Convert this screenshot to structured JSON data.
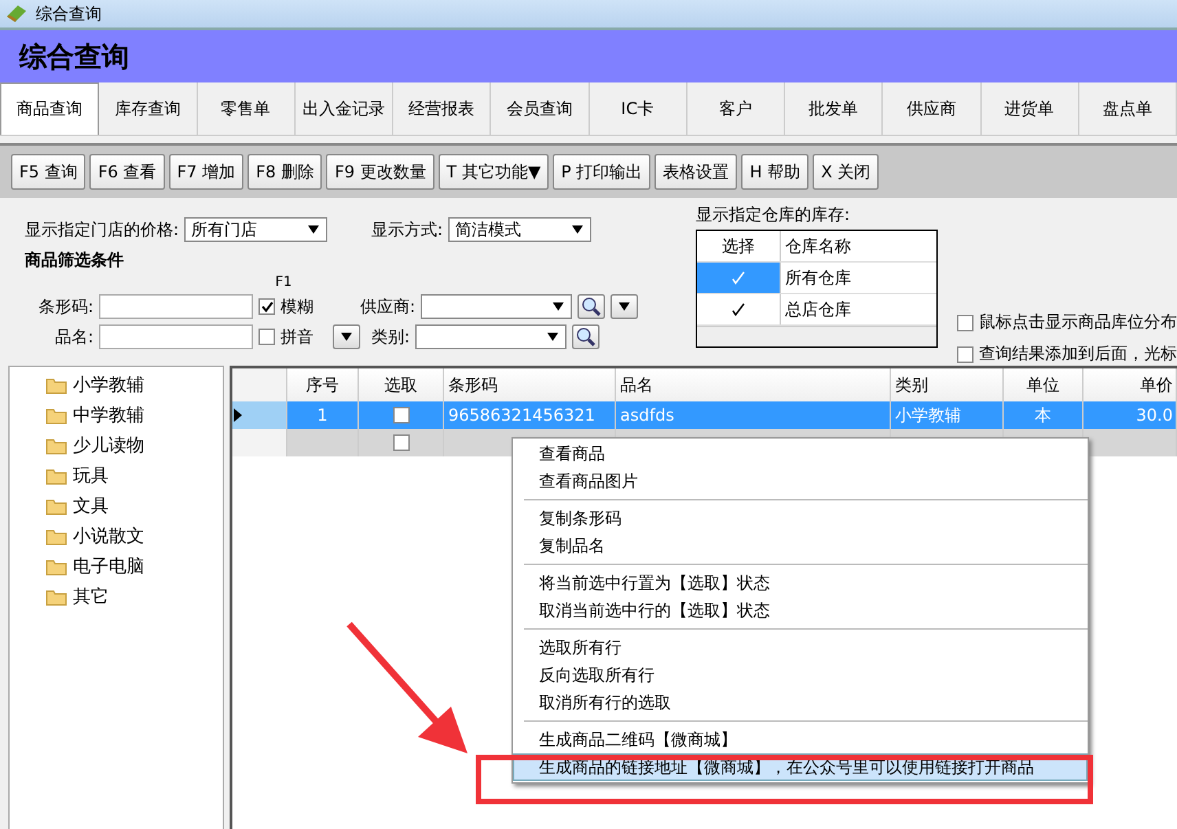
{
  "window": {
    "title": "综合查询"
  },
  "header": {
    "title": "综合查询"
  },
  "tabs": [
    {
      "label": "商品查询",
      "selected": true
    },
    {
      "label": "库存查询",
      "selected": false
    },
    {
      "label": "零售单",
      "selected": false
    },
    {
      "label": "出入金记录",
      "selected": false
    },
    {
      "label": "经营报表",
      "selected": false
    },
    {
      "label": "会员查询",
      "selected": false
    },
    {
      "label": "IC卡",
      "selected": false
    },
    {
      "label": "客户",
      "selected": false
    },
    {
      "label": "批发单",
      "selected": false
    },
    {
      "label": "供应商",
      "selected": false
    },
    {
      "label": "进货单",
      "selected": false
    },
    {
      "label": "盘点单",
      "selected": false
    }
  ],
  "toolbar": [
    "F5 查询",
    "F6 查看",
    "F7 增加",
    "F8 删除",
    "F9 更改数量",
    "T 其它功能▼",
    "P 打印输出",
    "表格设置",
    "H 帮助",
    "X 关闭"
  ],
  "filters": {
    "store_label": "显示指定门店的价格:",
    "store_value": "所有门店",
    "mode_label": "显示方式:",
    "mode_value": "简洁模式",
    "section_title": "商品筛选条件",
    "barcode_label": "条形码:",
    "f1_hint": "F1",
    "fuzzy": {
      "label": "模糊",
      "checked": true
    },
    "supplier_label": "供应商:",
    "name_label": "品名:",
    "pinyin": {
      "label": "拼音",
      "checked": false
    },
    "category_label": "类别:"
  },
  "warehouse": {
    "label": "显示指定仓库的库存:",
    "columns": [
      "选择",
      "仓库名称"
    ],
    "rows": [
      {
        "name": "所有仓库",
        "checked": true,
        "selected": true
      },
      {
        "name": "总店仓库",
        "checked": true,
        "selected": false
      }
    ]
  },
  "options": [
    {
      "label": "鼠标点击显示商品库位分布",
      "checked": false
    },
    {
      "label": "查询结果添加到后面，光标",
      "checked": false
    }
  ],
  "tree": [
    "小学教辅",
    "中学教辅",
    "少儿读物",
    "玩具",
    "文具",
    "小说散文",
    "电子电脑",
    "其它"
  ],
  "grid": {
    "columns": [
      "序号",
      "选取",
      "条形码",
      "品名",
      "类别",
      "单位",
      "单价"
    ],
    "rows": [
      {
        "selected": true,
        "checked": false,
        "cells": [
          "1",
          "",
          "96586321456321",
          "asdfds",
          "小学教辅",
          "本",
          "30.0"
        ]
      },
      {
        "selected": false,
        "checked": false,
        "cells": [
          "",
          "",
          "",
          "",
          "",
          "",
          ""
        ]
      }
    ]
  },
  "context_menu": {
    "groups": [
      [
        {
          "label": "查看商品",
          "selected": false
        },
        {
          "label": "查看商品图片",
          "selected": false
        }
      ],
      [
        {
          "label": "复制条形码",
          "selected": false
        },
        {
          "label": "复制品名",
          "selected": false
        }
      ],
      [
        {
          "label": "将当前选中行置为【选取】状态",
          "selected": false
        },
        {
          "label": "取消当前选中行的【选取】状态",
          "selected": false
        }
      ],
      [
        {
          "label": "选取所有行",
          "selected": false
        },
        {
          "label": "反向选取所有行",
          "selected": false
        },
        {
          "label": "取消所有行的选取",
          "selected": false
        }
      ],
      [
        {
          "label": "生成商品二维码【微商城】",
          "selected": false
        },
        {
          "label": "生成商品的链接地址【微商城】，在公众号里可以使用链接打开商品",
          "selected": true
        }
      ]
    ]
  }
}
